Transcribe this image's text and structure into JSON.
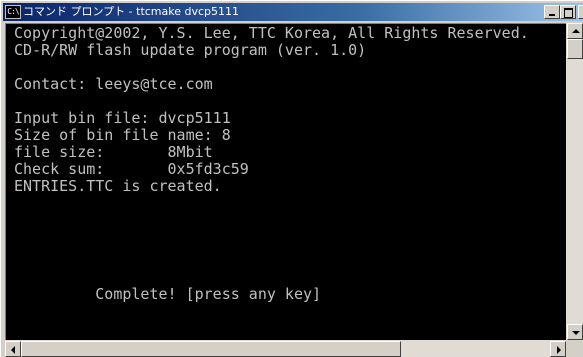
{
  "window": {
    "title": "コマンド プロンプト - ttcmake dvcp5111",
    "icon_text": "C:\\",
    "controls": {
      "minimize": "minimize-icon",
      "maximize": "maximize-icon",
      "close_label": "×"
    }
  },
  "console": {
    "lines": [
      "Copyright@2002, Y.S. Lee, TTC Korea, All Rights Reserved.",
      "CD-R/RW flash update program (ver. 1.0)",
      "",
      "Contact: leeys@tce.com",
      "",
      "Input bin file: dvcp5111",
      "Size of bin file name: 8",
      "file size:       8Mbit",
      "Check sum:       0x5fd3c59",
      "ENTRIES.TTC is created.",
      "",
      "",
      "",
      "",
      "         Complete! [press any key]"
    ]
  },
  "colors": {
    "titlebar_start": "#0a246a",
    "titlebar_end": "#a6caf0",
    "console_bg": "#000000",
    "console_text": "#c0c0c0"
  }
}
